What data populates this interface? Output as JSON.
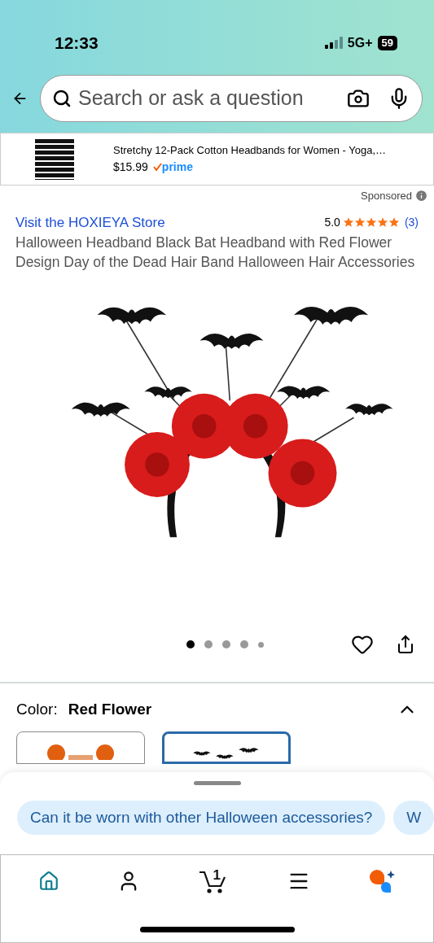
{
  "status_bar": {
    "time": "12:33",
    "network": "5G+",
    "battery": "59"
  },
  "search": {
    "placeholder": "Search or ask a question"
  },
  "ad": {
    "title": "Stretchy 12-Pack Cotton Headbands for Women - Yoga,…",
    "price": "$15.99",
    "badge": "prime"
  },
  "sponsored": "Sponsored",
  "store_link": "Visit the HOXIEYA Store",
  "rating": {
    "value": "5.0",
    "stars": 5,
    "count": "(3)"
  },
  "product_title": "Halloween Headband Black Bat Headband with Red Flower Design Day of the Dead Hair Band Halloween Hair Accessories",
  "carousel": [
    {
      "selected": true
    },
    {
      "selected": false
    },
    {
      "selected": false
    },
    {
      "selected": false
    },
    {
      "selected": false
    }
  ],
  "color": {
    "label": "Color:",
    "value": "Red Flower",
    "expanded": true
  },
  "swatches": [
    {
      "kind": "pumpkin",
      "selected": false
    },
    {
      "kind": "bat",
      "selected": true
    }
  ],
  "chips": [
    "Can it be worn with other Halloween accessories?",
    "W"
  ],
  "nav": [
    {
      "kind": "home",
      "selected": true
    },
    {
      "kind": "account",
      "selected": false
    },
    {
      "kind": "cart",
      "selected": false,
      "count": "1"
    },
    {
      "kind": "menu",
      "selected": false
    },
    {
      "kind": "assistant",
      "selected": false
    }
  ]
}
